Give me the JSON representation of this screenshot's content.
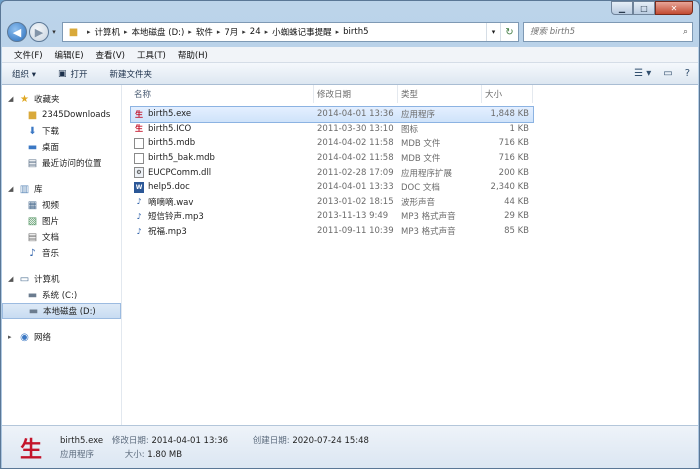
{
  "window": {
    "controls": {
      "minimize": "▁",
      "maximize": "□",
      "close": "✕"
    }
  },
  "address": {
    "crumbs": [
      "计算机",
      "本地磁盘 (D:)",
      "软件",
      "7月",
      "24",
      "小蜘蛛记事提醒",
      "birth5"
    ],
    "search_placeholder": "搜索 birth5"
  },
  "menu": [
    "文件(F)",
    "编辑(E)",
    "查看(V)",
    "工具(T)",
    "帮助(H)"
  ],
  "toolbar": {
    "organize": "组织 ▾",
    "open": "打开",
    "new_folder": "新建文件夹"
  },
  "nav": {
    "favorites": {
      "label": "收藏夹",
      "items": [
        "2345Downloads",
        "下载",
        "桌面",
        "最近访问的位置"
      ]
    },
    "libraries": {
      "label": "库",
      "items": [
        "视频",
        "图片",
        "文档",
        "音乐"
      ]
    },
    "computer": {
      "label": "计算机",
      "items": [
        "系统 (C:)",
        "本地磁盘 (D:)"
      ]
    },
    "network": {
      "label": "网络"
    }
  },
  "columns": {
    "name": "名称",
    "date": "修改日期",
    "type": "类型",
    "size": "大小"
  },
  "files": [
    {
      "name": "birth5.exe",
      "date": "2014-04-01 13:36",
      "type": "应用程序",
      "size": "1,848 KB",
      "icon": "exe-icon"
    },
    {
      "name": "birth5.ICO",
      "date": "2011-03-30 13:10",
      "type": "图标",
      "size": "1 KB",
      "icon": "exe-icon"
    },
    {
      "name": "birth5.mdb",
      "date": "2014-04-02 11:58",
      "type": "MDB 文件",
      "size": "716 KB",
      "icon": "doc-icon"
    },
    {
      "name": "birth5_bak.mdb",
      "date": "2014-04-02 11:58",
      "type": "MDB 文件",
      "size": "716 KB",
      "icon": "doc-icon"
    },
    {
      "name": "EUCPComm.dll",
      "date": "2011-02-28 17:09",
      "type": "应用程序扩展",
      "size": "200 KB",
      "icon": "dll-icon"
    },
    {
      "name": "help5.doc",
      "date": "2014-04-01 13:33",
      "type": "DOC 文档",
      "size": "2,340 KB",
      "icon": "word-icon"
    },
    {
      "name": "嘀嘀嘀.wav",
      "date": "2013-01-02 18:15",
      "type": "波形声音",
      "size": "44 KB",
      "icon": "music-icon"
    },
    {
      "name": "短信铃声.mp3",
      "date": "2013-11-13 9:49",
      "type": "MP3 格式声音",
      "size": "29 KB",
      "icon": "music-icon"
    },
    {
      "name": "祝福.mp3",
      "date": "2011-09-11 10:39",
      "type": "MP3 格式声音",
      "size": "85 KB",
      "icon": "music-icon"
    }
  ],
  "details": {
    "name": "birth5.exe",
    "modified_label": "修改日期:",
    "modified": "2014-04-01 13:36",
    "created_label": "创建日期:",
    "created": "2020-07-24 15:48",
    "type": "应用程序",
    "size_label": "大小:",
    "size": "1.80 MB"
  }
}
